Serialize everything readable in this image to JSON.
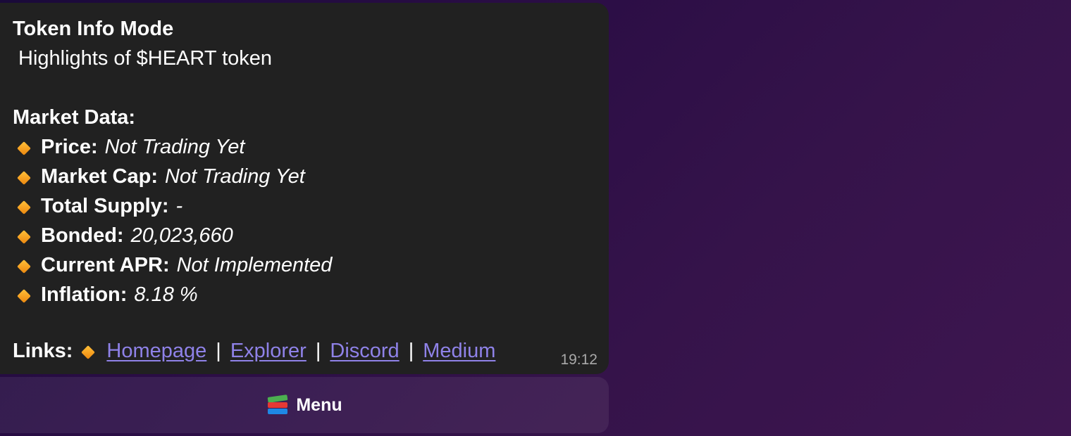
{
  "message": {
    "title": "Token Info Mode",
    "subtitle": "Highlights of $HEART token",
    "market_data_heading": "Market Data:",
    "items": [
      {
        "label": "Price:",
        "value": "Not Trading Yet"
      },
      {
        "label": "Market Cap:",
        "value": "Not Trading Yet"
      },
      {
        "label": "Total Supply:",
        "value": "-"
      },
      {
        "label": "Bonded:",
        "value": "20,023,660"
      },
      {
        "label": "Current APR:",
        "value": "Not Implemented"
      },
      {
        "label": "Inflation:",
        "value": "8.18 %"
      }
    ],
    "bullet_icon": "orange-diamond-icon",
    "links_label": "Links:",
    "links": [
      "Homepage",
      "Explorer",
      "Discord",
      "Medium"
    ],
    "separator": "|",
    "timestamp": "19:12"
  },
  "menu_button": {
    "icon": "books-icon",
    "label": "Menu"
  },
  "colors": {
    "bubble_background": "#212121",
    "link": "#8f82e8",
    "bullet": "#f7a021",
    "background_start": "#1a0a3a",
    "background_end": "#3e1650"
  }
}
